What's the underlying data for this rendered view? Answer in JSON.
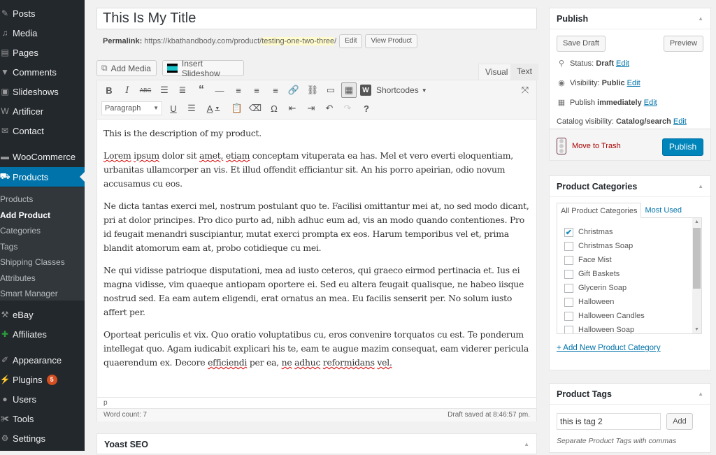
{
  "sidebar": {
    "items": [
      {
        "label": "Posts",
        "icon": "pin-icon"
      },
      {
        "label": "Media",
        "icon": "media-icon"
      },
      {
        "label": "Pages",
        "icon": "pages-icon"
      },
      {
        "label": "Comments",
        "icon": "comment-icon"
      },
      {
        "label": "Slideshows",
        "icon": "slideshow-icon"
      },
      {
        "label": "Artificer",
        "icon": "artificer-icon"
      },
      {
        "label": "Contact",
        "icon": "mail-icon"
      },
      {
        "label": "WooCommerce",
        "icon": "woocommerce-icon"
      },
      {
        "label": "Products",
        "icon": "cart-icon",
        "active": true
      },
      {
        "label": "eBay",
        "icon": "gavel-icon"
      },
      {
        "label": "Affiliates",
        "icon": "affiliates-icon"
      },
      {
        "label": "Appearance",
        "icon": "brush-icon"
      },
      {
        "label": "Plugins",
        "icon": "plug-icon",
        "badge": "5"
      },
      {
        "label": "Users",
        "icon": "user-icon"
      },
      {
        "label": "Tools",
        "icon": "wrench-icon"
      },
      {
        "label": "Settings",
        "icon": "settings-icon"
      }
    ],
    "submenu": [
      "Products",
      "Add Product",
      "Categories",
      "Tags",
      "Shipping Classes",
      "Attributes",
      "Smart Manager"
    ],
    "submenu_current": "Add Product"
  },
  "post": {
    "title": "This Is My Title",
    "permalink_label": "Permalink:",
    "permalink_base": "https://kbathandbody.com/product/",
    "permalink_slug": "testing-one-two-three",
    "permalink_trail": "/",
    "edit_label": "Edit",
    "view_label": "View Product"
  },
  "editor": {
    "add_media": "Add Media",
    "insert_slideshow": "Insert Slideshow",
    "tab_visual": "Visual",
    "tab_text": "Text",
    "shortcodes_label": "Shortcodes",
    "format_select": "Paragraph",
    "path": "p",
    "word_count": "Word count: 7",
    "draft_saved": "Draft saved at 8:46:57 pm.",
    "paragraphs": {
      "p1": "This is the description of my product.",
      "p2": "Lorem ipsum dolor sit amet, etiam conceptam vituperata ea has. Mel et vero everti eloquentiam, urbanitas ullamcorper an vis. Et illud offendit efficiantur sit. An his porro apeirian, odio novum accusamus cu eos.",
      "p3": "Ne dicta tantas exerci mel, nostrum postulant quo te. Facilisi omittantur mei at, no sed modo dicant, pri at dolor principes. Pro dico purto ad, nibh adhuc eum ad, vis an modo quando contentiones. Pro id feugait menandri suscipiantur, mutat exerci prompta ex eos. Harum temporibus vel et, prima blandit atomorum eam at, probo cotidieque cu mei.",
      "p4": "Ne qui vidisse patrioque disputationi, mea ad iusto ceteros, qui graeco eirmod pertinacia et. Ius ei magna vidisse, vim quaeque antiopam oportere ei. Sed eu altera feugait qualisque, ne habeo iisque nostrud sed. Ea eam autem eligendi, erat ornatus an mea. Eu facilis senserit per. No solum iusto affert per.",
      "p5": "Oporteat periculis et vix. Quo oratio voluptatibus cu, eros convenire torquatos cu est. Te ponderum intellegat quo. Agam iudicabit explicari his te, eam te augue mazim consequat, eam viderer pericula quaerendum ex. Decore efficiendi per ea, ne adhuc reformidans vel."
    }
  },
  "yoast": {
    "title": "Yoast SEO"
  },
  "publish": {
    "title": "Publish",
    "save_draft": "Save Draft",
    "preview": "Preview",
    "status_label": "Status:",
    "status_value": "Draft",
    "visibility_label": "Visibility:",
    "visibility_value": "Public",
    "publish_label": "Publish",
    "publish_value": "immediately",
    "catalog_label": "Catalog visibility:",
    "catalog_value": "Catalog/search",
    "edit": "Edit",
    "trash": "Move to Trash",
    "publish_button": "Publish"
  },
  "categories": {
    "title": "Product Categories",
    "tab_all": "All Product Categories",
    "tab_most": "Most Used",
    "items": [
      {
        "label": "Christmas",
        "checked": true
      },
      {
        "label": "Christmas Soap",
        "checked": false
      },
      {
        "label": "Face Mist",
        "checked": false
      },
      {
        "label": "Gift Baskets",
        "checked": false
      },
      {
        "label": "Glycerin Soap",
        "checked": false
      },
      {
        "label": "Halloween",
        "checked": false
      },
      {
        "label": "Halloween Candles",
        "checked": false
      },
      {
        "label": "Halloween Soap",
        "checked": false
      }
    ],
    "add_new": "+ Add New Product Category"
  },
  "tags": {
    "title": "Product Tags",
    "input_value": "this is tag 2",
    "add": "Add",
    "hint": "Separate Product Tags with commas"
  },
  "colors": {
    "accent": "#0073aa",
    "publish": "#0085ba",
    "sidebar": "#23282d",
    "badge": "#d54e21",
    "trash": "#a00000"
  }
}
